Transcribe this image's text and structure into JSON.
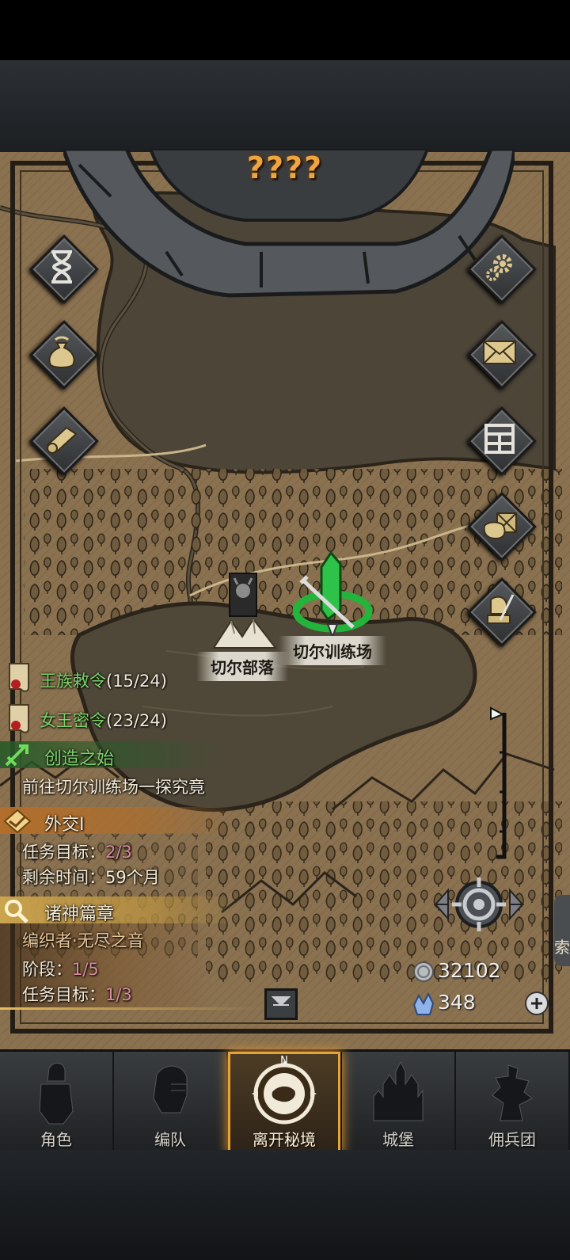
{
  "map_title": "????",
  "locations": {
    "tribe_label": "切尔部落",
    "training_label": "切尔训练场"
  },
  "left_buttons": [
    "hourglass-icon",
    "money-bag-icon",
    "scroll-icon"
  ],
  "right_buttons": [
    "gear-icon",
    "mail-icon",
    "map-grid-icon",
    "supplies-icon",
    "knight-icon"
  ],
  "quests": {
    "royal_decree": {
      "title": "王族敕令",
      "progress": "(15/24)"
    },
    "queen_order": {
      "title": "女王密令",
      "progress": "(23/24)"
    },
    "origin": {
      "title": "创造之始",
      "desc": "前往切尔训练场一探究竟"
    },
    "diplomacy": {
      "title": "外交I",
      "target_label": "任务目标：",
      "target_value": "2/3",
      "time_label": "剩余时间：",
      "time_value": "59个月"
    },
    "gods": {
      "title": "诸神篇章",
      "subtitle": "编织者·无尽之音",
      "stage_label": "阶段：",
      "stage_value": "1/5",
      "target_label": "任务目标：",
      "target_value": "1/3"
    }
  },
  "resources": {
    "silver": "32102",
    "crystal": "348"
  },
  "side_text": "索",
  "nav": [
    {
      "label": "角色",
      "icon": "character-icon",
      "active": false
    },
    {
      "label": "编队",
      "icon": "team-icon",
      "active": false
    },
    {
      "label": "离开秘境",
      "icon": "compass-icon",
      "active": true
    },
    {
      "label": "城堡",
      "icon": "castle-icon",
      "active": false
    },
    {
      "label": "佣兵团",
      "icon": "mercenary-icon",
      "active": false
    }
  ],
  "compass_letter": "N",
  "colors": {
    "accent": "#e8a23a",
    "quest_green": "#7cd36a",
    "quest_pink": "#d98aa0",
    "map_parchment": "#8d7452"
  }
}
